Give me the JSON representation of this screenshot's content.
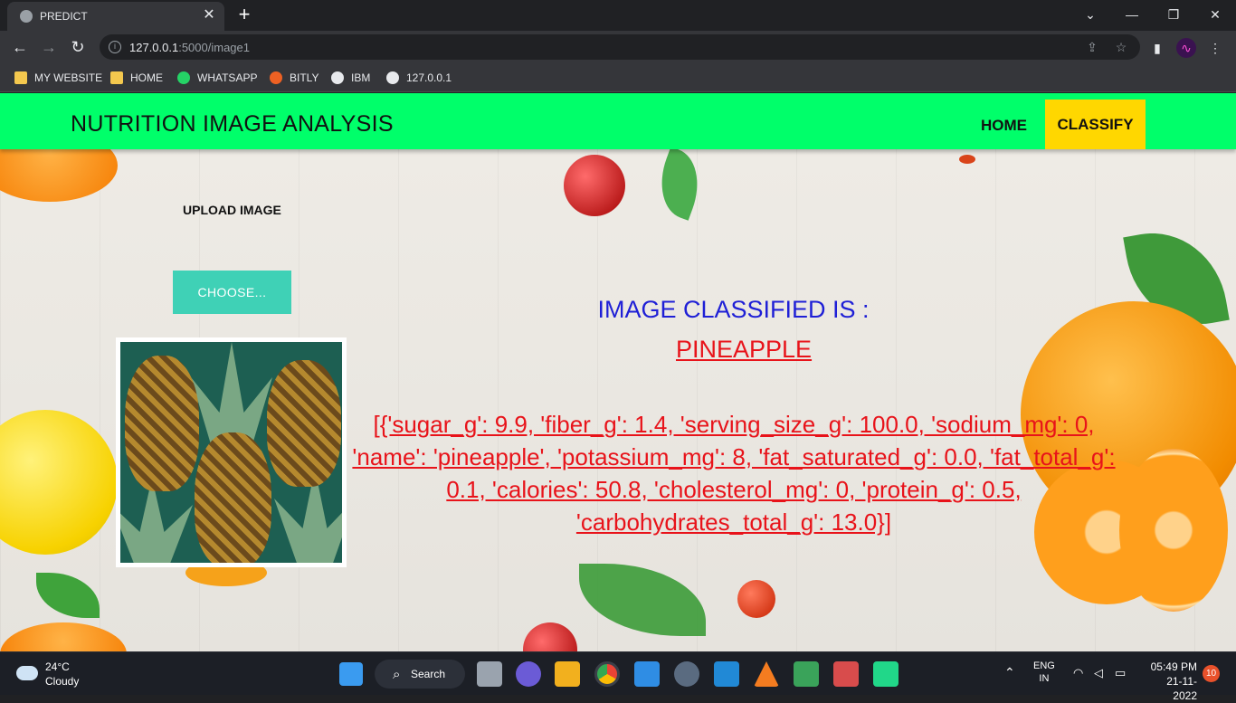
{
  "browser": {
    "tab_title": "PREDICT",
    "url_host": "127.0.0.1",
    "url_rest": ":5000/image1",
    "bookmarks": [
      {
        "label": "MY WEBSITE",
        "icon": "folder-icon"
      },
      {
        "label": "HOME",
        "icon": "folder-icon"
      },
      {
        "label": "WHATSAPP",
        "icon": "whatsapp-icon"
      },
      {
        "label": "BITLY",
        "icon": "bitly-icon"
      },
      {
        "label": "IBM",
        "icon": "globe-icon"
      },
      {
        "label": "127.0.0.1",
        "icon": "globe-icon"
      }
    ]
  },
  "navbar": {
    "brand": "NUTRITION IMAGE ANALYSIS",
    "home": "HOME",
    "classify": "CLASSIFY",
    "active_color": "#ffd700",
    "bar_color": "#00ff6a"
  },
  "upload": {
    "label": "UPLOAD IMAGE",
    "choose": "CHOOSE..."
  },
  "result": {
    "title": "IMAGE CLASSIFIED IS :",
    "value": "PINEAPPLE",
    "json": "[{'sugar_g': 9.9, 'fiber_g': 1.4, 'serving_size_g': 100.0, 'sodium_mg': 0, 'name': 'pineapple', 'potassium_mg': 8, 'fat_saturated_g': 0.0, 'fat_total_g': 0.1, 'calories': 50.8, 'cholesterol_mg': 0, 'protein_g': 0.5, 'carbohydrates_total_g': 13.0}]"
  },
  "taskbar": {
    "temp": "24°C",
    "weather": "Cloudy",
    "search": "Search",
    "lang1": "ENG",
    "lang2": "IN",
    "time": "05:49 PM",
    "date": "21-11-2022",
    "notifications": "10"
  }
}
